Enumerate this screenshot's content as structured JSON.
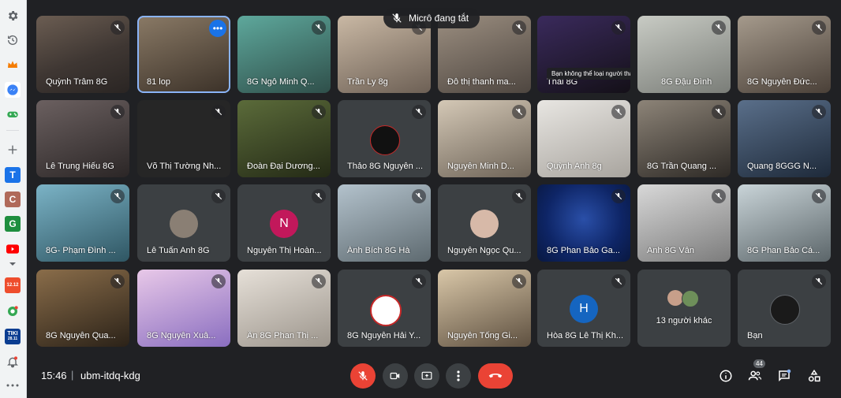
{
  "toast": {
    "label": "Micrô đang tắt"
  },
  "tooltip": {
    "text": "Bạn không thể loại người tham gia này"
  },
  "participants": [
    {
      "name": "Quỳnh Trâm 8G"
    },
    {
      "name": "81 lop"
    },
    {
      "name": "8G Ngô Minh Q..."
    },
    {
      "name": "Trần Ly 8g"
    },
    {
      "name": "Đỗ thị thanh ma..."
    },
    {
      "name": "Thái 8G"
    },
    {
      "name": "8G Đậu Đình"
    },
    {
      "name": "8G Nguyễn Đức..."
    },
    {
      "name": "Lê Trung Hiếu 8G"
    },
    {
      "name": "Võ Thị Tường Nh..."
    },
    {
      "name": "Đoàn Đại Dương..."
    },
    {
      "name": "Thảo 8G Nguyễn ..."
    },
    {
      "name": "Nguyễn Minh D..."
    },
    {
      "name": "Quỳnh Anh 8g"
    },
    {
      "name": "8G Trần Quang ..."
    },
    {
      "name": "Quang 8GGG N..."
    },
    {
      "name": "8G- Phạm Đình ..."
    },
    {
      "name": "Lê Tuấn Anh 8G"
    },
    {
      "name": "Nguyễn Thị Hoàn...",
      "initial": "N"
    },
    {
      "name": "Ánh Bích 8G Hà"
    },
    {
      "name": "Nguyễn Ngọc Qu..."
    },
    {
      "name": "8G Phan Bảo Ga..."
    },
    {
      "name": "Anh 8G Vân"
    },
    {
      "name": "8G Phan Bảo Cá..."
    },
    {
      "name": "8G Nguyễn Qua..."
    },
    {
      "name": "8G Nguyễn Xuâ..."
    },
    {
      "name": "Ân 8G Phan Thị ..."
    },
    {
      "name": "8G Nguyễn Hải Y..."
    },
    {
      "name": "Nguyễn Tống Gi..."
    },
    {
      "name": "Hòa 8G Lê Thị Kh...",
      "initial": "H"
    },
    {
      "name": "13 người khác"
    },
    {
      "name": "Bạn"
    }
  ],
  "bottom_bar": {
    "time": "15:46",
    "separator": "|",
    "meeting_code": "ubm-itdq-kdg",
    "people_count": "44"
  },
  "sidebar": {
    "icons": [
      "settings-icon",
      "history-icon",
      "crown-icon",
      "messenger-icon",
      "gamepad-icon",
      "add-icon",
      "t-app-icon",
      "c-app-icon",
      "g-app-icon",
      "youtube-icon",
      "chevron-down-icon",
      "shopee-icon",
      "chat-bubble-icon",
      "tiki-icon",
      "bell-icon",
      "more-icon"
    ],
    "tiki_label": "TIKI",
    "tiki_date": "28.11",
    "shopee_label": "12.12"
  },
  "colors": {
    "accent": "#8ab4f8",
    "danger": "#ea4335",
    "tile": "#3c4043",
    "bg": "#202124"
  }
}
